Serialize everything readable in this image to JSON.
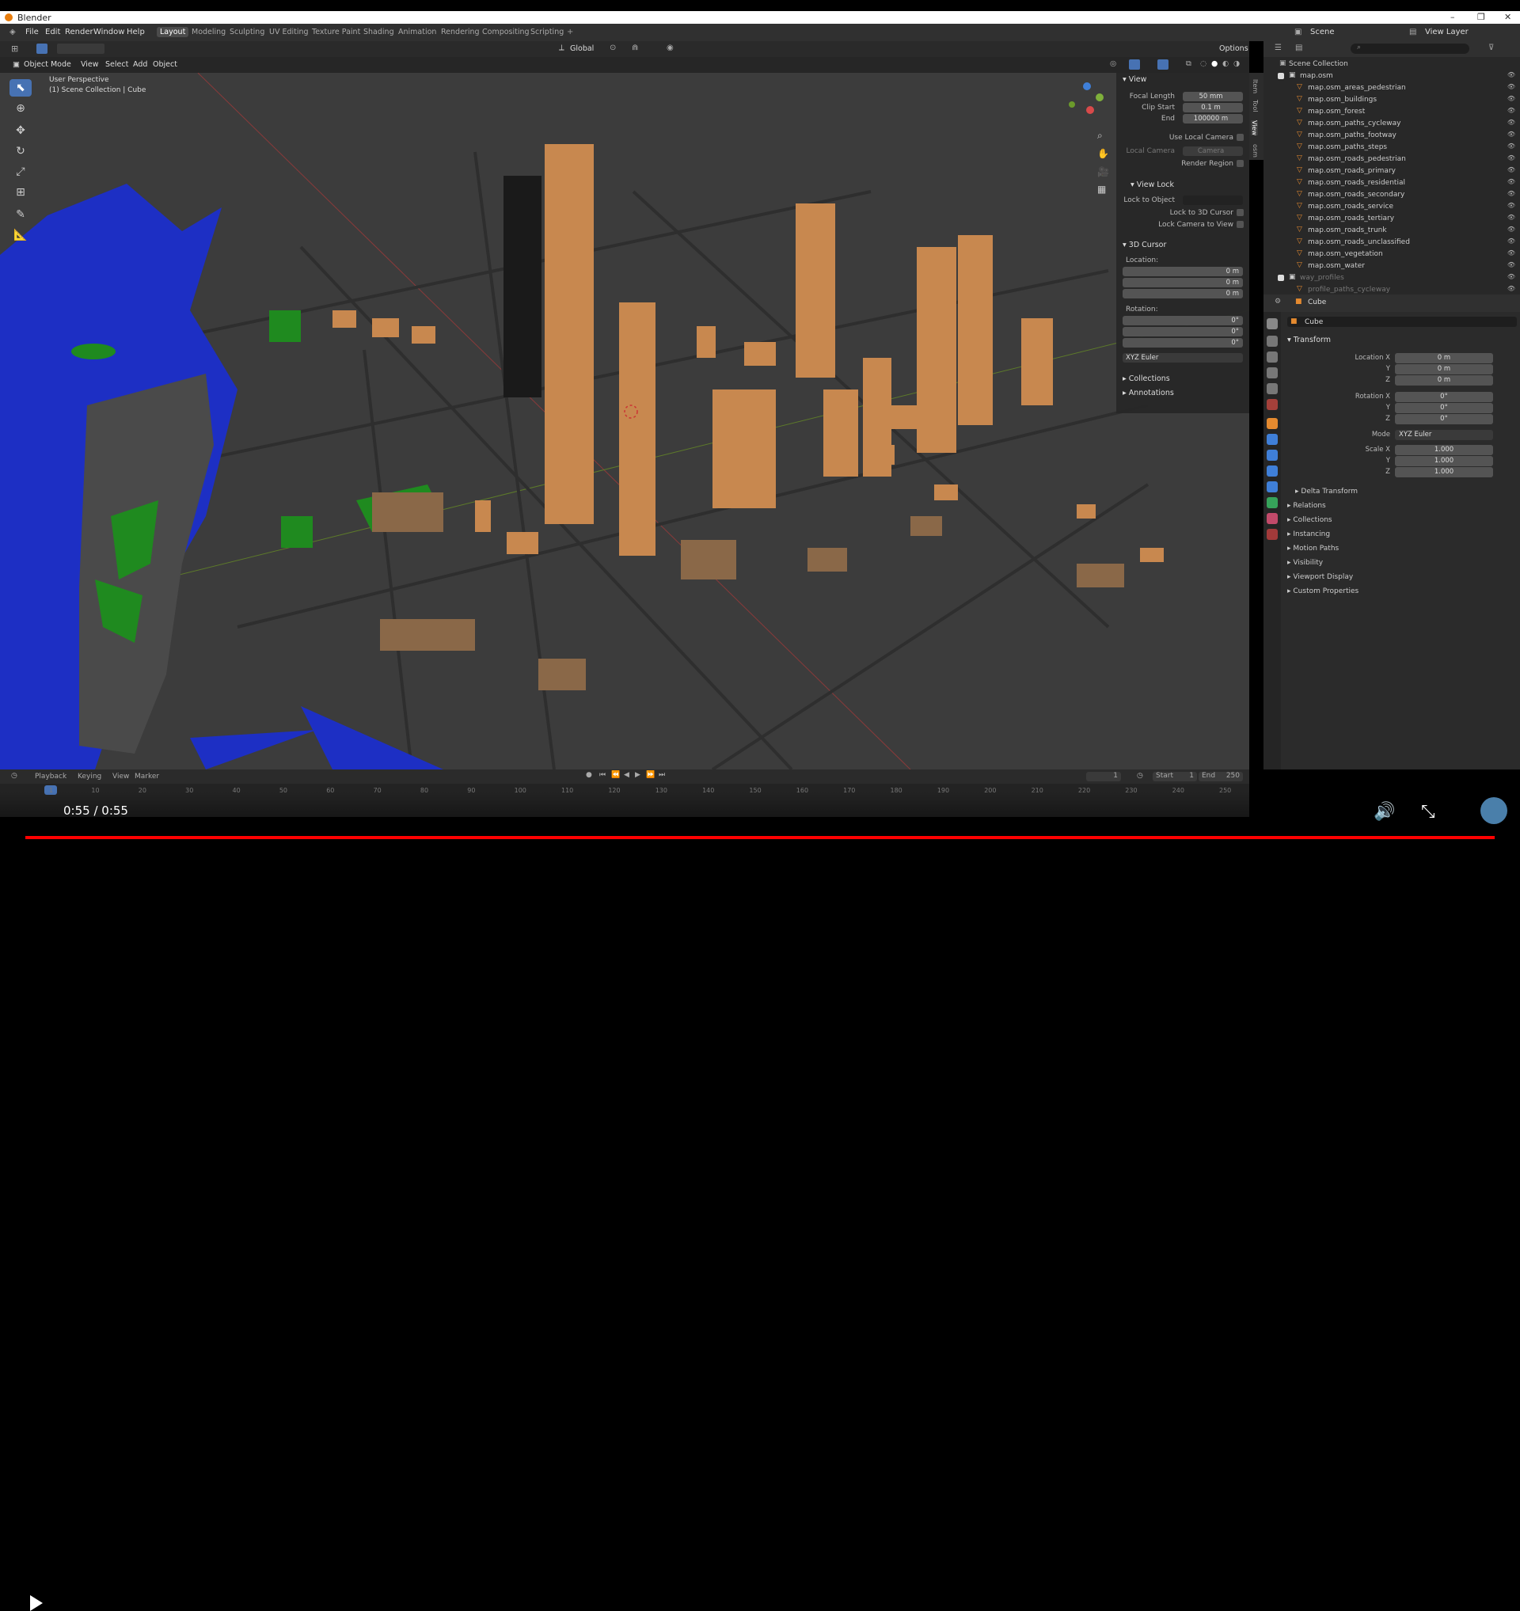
{
  "window": {
    "title": "Blender"
  },
  "menus": [
    "File",
    "Edit",
    "Render",
    "Window",
    "Help"
  ],
  "workspaces": [
    "Layout",
    "Modeling",
    "Sculpting",
    "UV Editing",
    "Texture Paint",
    "Shading",
    "Animation",
    "Rendering",
    "Compositing",
    "Scripting"
  ],
  "active_workspace": "Layout",
  "topright": {
    "scene": "Scene",
    "view_layer": "View Layer"
  },
  "header2": {
    "orientation": "Global",
    "options": "Options"
  },
  "viewport_header": {
    "mode": "Object Mode",
    "view": "View",
    "select": "Select",
    "add": "Add",
    "object": "Object"
  },
  "viewport_info": {
    "perspective": "User Perspective",
    "collection": "(1) Scene Collection | Cube"
  },
  "npanel": {
    "view_title": "View",
    "focal_length_label": "Focal Length",
    "focal_length": "50 mm",
    "clip_start_label": "Clip Start",
    "clip_start": "0.1 m",
    "end_label": "End",
    "end": "100000 m",
    "use_local_camera": "Use Local Camera",
    "local_camera_label": "Local Camera",
    "local_camera": "Camera",
    "render_region": "Render Region",
    "view_lock_title": "View Lock",
    "lock_to_object": "Lock to Object",
    "lock_to_cursor": "Lock to 3D Cursor",
    "lock_camera": "Lock Camera to View",
    "cursor_title": "3D Cursor",
    "location_label": "Location:",
    "loc_x": "0 m",
    "loc_y": "0 m",
    "loc_z": "0 m",
    "rotation_label": "Rotation:",
    "rot_x": "0°",
    "rot_y": "0°",
    "rot_z": "0°",
    "rotation_mode": "XYZ Euler",
    "collections": "Collections",
    "annotations": "Annotations",
    "tabs": [
      "Item",
      "Tool",
      "View",
      "osm"
    ]
  },
  "outliner": {
    "header": "Scene Collection",
    "items": [
      {
        "name": "map.osm"
      },
      {
        "name": "map.osm_areas_pedestrian"
      },
      {
        "name": "map.osm_buildings"
      },
      {
        "name": "map.osm_forest"
      },
      {
        "name": "map.osm_paths_cycleway"
      },
      {
        "name": "map.osm_paths_footway"
      },
      {
        "name": "map.osm_paths_steps"
      },
      {
        "name": "map.osm_roads_pedestrian"
      },
      {
        "name": "map.osm_roads_primary"
      },
      {
        "name": "map.osm_roads_residential"
      },
      {
        "name": "map.osm_roads_secondary"
      },
      {
        "name": "map.osm_roads_service"
      },
      {
        "name": "map.osm_roads_tertiary"
      },
      {
        "name": "map.osm_roads_trunk"
      },
      {
        "name": "map.osm_roads_unclassified"
      },
      {
        "name": "map.osm_vegetation"
      },
      {
        "name": "map.osm_water"
      },
      {
        "name": "way_profiles"
      },
      {
        "name": "profile_paths_cycleway"
      }
    ]
  },
  "properties": {
    "object_name": "Cube",
    "data_name": "Cube",
    "transform": "Transform",
    "location_x_label": "Location X",
    "y_label": "Y",
    "z_label": "Z",
    "loc_x": "0 m",
    "loc_y": "0 m",
    "loc_z": "0 m",
    "rotation_x_label": "Rotation X",
    "rot_x": "0°",
    "rot_y": "0°",
    "rot_z": "0°",
    "mode_label": "Mode",
    "mode": "XYZ Euler",
    "scale_x_label": "Scale X",
    "scale_x": "1.000",
    "scale_y": "1.000",
    "scale_z": "1.000",
    "sections": [
      "Delta Transform",
      "Relations",
      "Collections",
      "Instancing",
      "Motion Paths",
      "Visibility",
      "Viewport Display",
      "Custom Properties"
    ]
  },
  "timeline": {
    "menus": [
      "Playback",
      "Keying",
      "View",
      "Marker"
    ],
    "current_frame": "1",
    "start_label": "Start",
    "start": "1",
    "end_label": "End",
    "end": "250",
    "ticks": [
      "1",
      "10",
      "20",
      "30",
      "40",
      "50",
      "60",
      "70",
      "80",
      "90",
      "100",
      "110",
      "120",
      "130",
      "140",
      "150",
      "160",
      "170",
      "180",
      "190",
      "200",
      "210",
      "220",
      "230",
      "240",
      "250"
    ]
  },
  "video": {
    "time": "0:55 / 0:55",
    "progress": 1.0,
    "progress_color": "#ff0000"
  },
  "colors": {
    "accent": "#4772b3",
    "building": "#c8884f",
    "water": "#1d2fc4",
    "park": "#1f8a1f",
    "ground": "#3d3d3d"
  }
}
